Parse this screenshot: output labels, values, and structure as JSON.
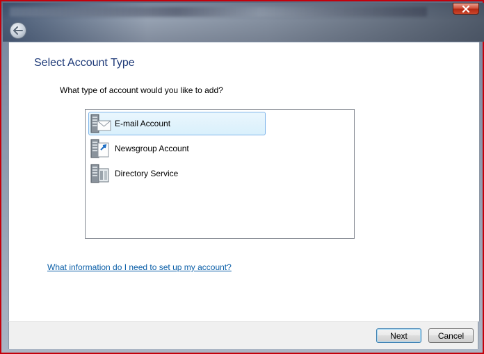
{
  "window": {
    "close_icon": "close-icon",
    "back_icon": "back-arrow-icon"
  },
  "page": {
    "title": "Select Account Type",
    "question": "What type of account would you like to add?"
  },
  "account_types": {
    "items": [
      {
        "label": "E-mail Account",
        "icon": "email-account-icon",
        "selected": true
      },
      {
        "label": "Newsgroup Account",
        "icon": "newsgroup-account-icon",
        "selected": false
      },
      {
        "label": "Directory Service",
        "icon": "directory-service-icon",
        "selected": false
      }
    ]
  },
  "help_link": "What information do I need to set up my account?",
  "buttons": {
    "next": "Next",
    "cancel": "Cancel"
  },
  "colors": {
    "window_border": "#c4000b",
    "title_text": "#1e3a78",
    "link": "#0b5fa8",
    "selection_border": "#7eb4ea"
  }
}
